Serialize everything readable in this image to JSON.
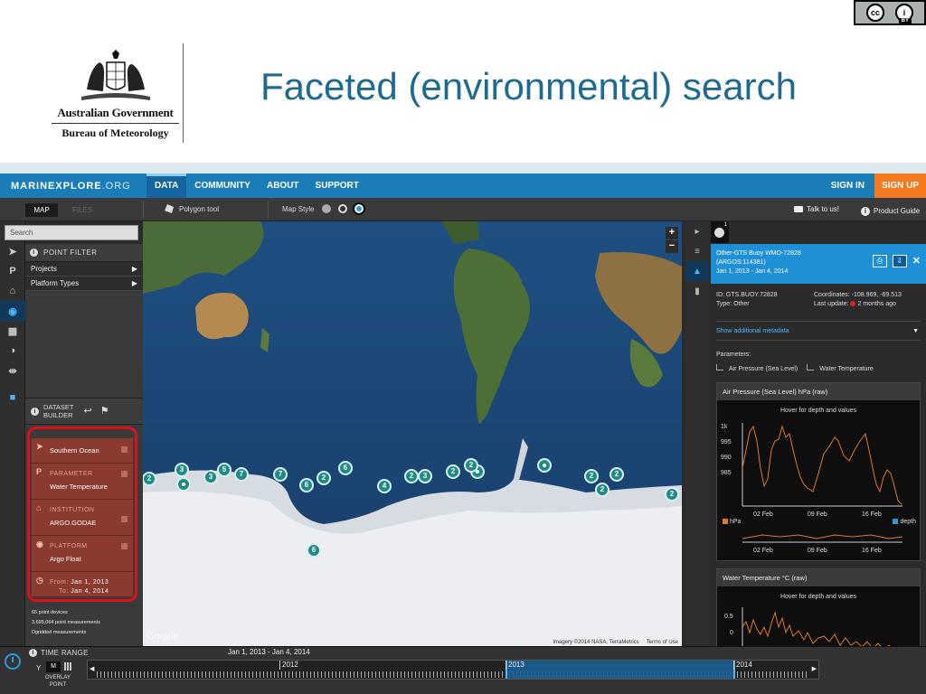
{
  "slide": {
    "title": "Faceted (environmental) search",
    "cc_badge": {
      "mark": "cc",
      "attribution_icon": "i",
      "by": "BY"
    },
    "logo": {
      "line1": "Australian Government",
      "line2": "Bureau of Meteorology"
    }
  },
  "app": {
    "brand": {
      "name": "MARINEXPLORE",
      "suffix": ".ORG"
    },
    "nav": [
      "DATA",
      "COMMUNITY",
      "ABOUT",
      "SUPPORT"
    ],
    "signin": "SIGN IN",
    "signup": "SIGN UP",
    "toolbar": {
      "tab_map": "MAP",
      "tab_files": "FILES",
      "polygon_tool": "Polygon tool",
      "map_style": "Map Style",
      "talk": "Talk to us!",
      "product_guide": "Product Guide"
    },
    "search_placeholder": "Search",
    "point_filter": {
      "title": "POINT FILTER",
      "rows": [
        "Projects",
        "Platform Types"
      ]
    },
    "dataset_builder": {
      "title_line1": "DATASET",
      "title_line2": "BUILDER"
    },
    "facets": {
      "region": "Southern Ocean",
      "parameter_label": "PARAMETER",
      "parameter_value": "Water Temperature",
      "institution_label": "INSTITUTION",
      "institution_value": "ARGO.GODAE",
      "platform_label": "PLATFORM",
      "platform_value": "Argo Float",
      "from_label": "From:",
      "from_value": "Jan 1, 2013",
      "to_label": "To:",
      "to_value": "Jan 4, 2014"
    },
    "stats": [
      "65 point devices",
      "3,695,064 point measurements",
      "Dgridded measurements"
    ],
    "map": {
      "zoom_in": "+",
      "zoom_out": "−",
      "markers": [
        "2",
        "3",
        "•",
        "3",
        "5",
        "7",
        "7",
        "6",
        "2",
        "6",
        "4",
        "2",
        "3",
        "2",
        "•",
        "2",
        "•",
        "2",
        "2",
        "2",
        "2",
        "6"
      ],
      "google": "Google",
      "attribution": [
        "Imagery ©2014 NASA, TerraMetrics",
        "Terms of Use"
      ]
    },
    "detail": {
      "tab_count": "1",
      "name": "Other-GTS Buoy WMO-72828",
      "argos": "(ARGOS:114381)",
      "range": "Jan 1, 2013 - Jan 4, 2014",
      "id": "ID: GTS.BUOY.72828",
      "type": "Type: Other",
      "coordinates": "Coordinates: -108.969, -69.513",
      "last_update_label": "Last update:",
      "last_update_value": "2 months ago",
      "show_meta": "Show additional metadata",
      "parameters_label": "Parameters:",
      "parameters": [
        "Air Pressure (Sea Level)",
        "Water Temperature"
      ],
      "chart1": {
        "title": "Air Pressure (Sea Level) hPa (raw)",
        "hover": "Hover for depth and values",
        "yticks": [
          "1k",
          "995",
          "990",
          "985"
        ],
        "xticks": [
          "02 Feb",
          "09 Feb",
          "16 Feb"
        ],
        "legend_left": "hPa",
        "legend_right": "depth"
      },
      "chart2": {
        "title": "Water Temperature °C (raw)",
        "hover": "Hover for depth and values",
        "yticks": [
          "0.5",
          "0"
        ]
      }
    },
    "time_range": {
      "label": "TIME RANGE",
      "dates": "Jan 1, 2013 - Jan 4, 2014",
      "y": "Y",
      "m": "M",
      "overlay_line1": "OVERLAY",
      "overlay_line2": "POINT",
      "years": [
        "2012",
        "2013",
        "2014"
      ]
    }
  },
  "colors": {
    "title_blue": "#1f6b8f",
    "nav_blue": "#1a7db8",
    "signup_orange": "#f47a20",
    "facet_red": "#8a3a2e",
    "highlight_red": "#e00e1a",
    "marker_teal": "#1f8a86",
    "chart_orange": "#e07a2a"
  }
}
